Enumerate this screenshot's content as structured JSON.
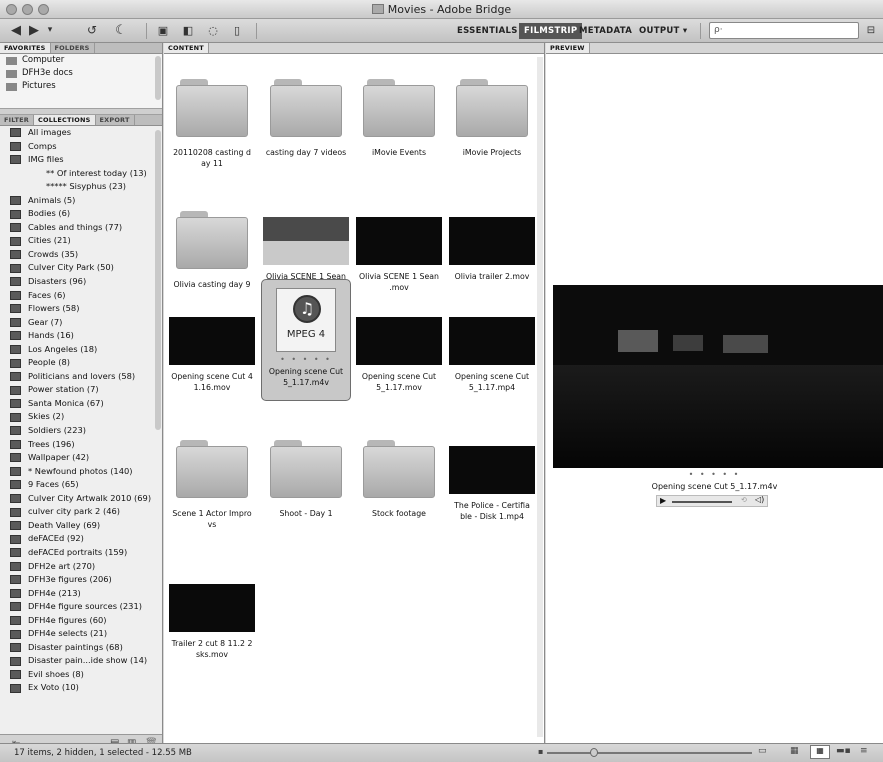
{
  "window": {
    "title": "Movies - Adobe Bridge"
  },
  "toolbar": {
    "back_icon": "arrow-left-icon",
    "forward_icon": "arrow-right-icon",
    "workspaces": [
      "ESSENTIALS",
      "FILMSTRIP",
      "METADATA",
      "OUTPUT ▾"
    ],
    "active_workspace": "FILMSTRIP",
    "search_placeholder": "ρ·"
  },
  "left_top_tabs": [
    "FAVORITES",
    "FOLDERS"
  ],
  "favorites": [
    "Computer",
    "DFH3e docs",
    "Pictures"
  ],
  "left_bottom_tabs": [
    "FILTER",
    "COLLECTIONS",
    "EXPORT"
  ],
  "collections": [
    {
      "label": "All images",
      "sub": false
    },
    {
      "label": "Comps",
      "sub": false
    },
    {
      "label": "IMG files",
      "sub": false
    },
    {
      "label": "** Of interest today (13)",
      "sub": true
    },
    {
      "label": "***** Sisyphus (23)",
      "sub": true
    },
    {
      "label": "Animals (5)",
      "sub": false
    },
    {
      "label": "Bodies (6)",
      "sub": false
    },
    {
      "label": "Cables and things (77)",
      "sub": false
    },
    {
      "label": "Cities (21)",
      "sub": false
    },
    {
      "label": "Crowds (35)",
      "sub": false
    },
    {
      "label": "Culver City Park (50)",
      "sub": false
    },
    {
      "label": "Disasters (96)",
      "sub": false
    },
    {
      "label": "Faces (6)",
      "sub": false
    },
    {
      "label": "Flowers (58)",
      "sub": false
    },
    {
      "label": "Gear (7)",
      "sub": false
    },
    {
      "label": "Hands (16)",
      "sub": false
    },
    {
      "label": "Los Angeles (18)",
      "sub": false
    },
    {
      "label": "People (8)",
      "sub": false
    },
    {
      "label": "Politicians and lovers (58)",
      "sub": false
    },
    {
      "label": "Power station (7)",
      "sub": false
    },
    {
      "label": "Santa Monica (67)",
      "sub": false
    },
    {
      "label": "Skies (2)",
      "sub": false
    },
    {
      "label": "Soldiers (223)",
      "sub": false
    },
    {
      "label": "Trees (196)",
      "sub": false
    },
    {
      "label": "Wallpaper (42)",
      "sub": false
    },
    {
      "label": "* Newfound photos (140)",
      "sub": false
    },
    {
      "label": "9 Faces (65)",
      "sub": false
    },
    {
      "label": "Culver City Artwalk 2010 (69)",
      "sub": false
    },
    {
      "label": "culver city park 2 (46)",
      "sub": false
    },
    {
      "label": "Death Valley (69)",
      "sub": false
    },
    {
      "label": "deFACEd (92)",
      "sub": false
    },
    {
      "label": "deFACEd portraits (159)",
      "sub": false
    },
    {
      "label": "DFH2e art (270)",
      "sub": false
    },
    {
      "label": "DFH3e figures (206)",
      "sub": false
    },
    {
      "label": "DFH4e (213)",
      "sub": false
    },
    {
      "label": "DFH4e figure sources (231)",
      "sub": false
    },
    {
      "label": "DFH4e figures (60)",
      "sub": false
    },
    {
      "label": "DFH4e selects (21)",
      "sub": false
    },
    {
      "label": "Disaster paintings (68)",
      "sub": false
    },
    {
      "label": "Disaster pain...ide show (14)",
      "sub": false
    },
    {
      "label": "Evil shoes (8)",
      "sub": false
    },
    {
      "label": "Ex Voto (10)",
      "sub": false
    }
  ],
  "content": {
    "tab": "CONTENT",
    "items": [
      {
        "type": "folder",
        "label": "20110208 casting d ay 11"
      },
      {
        "type": "folder",
        "label": "casting day 7 videos"
      },
      {
        "type": "folder",
        "label": "iMovie Events"
      },
      {
        "type": "folder",
        "label": "iMovie Projects"
      },
      {
        "type": "folder",
        "label": "Olivia casting day 9"
      },
      {
        "type": "video",
        "label": "Olivia SCENE 1 Sean _MP4 3....16x9).mp4"
      },
      {
        "type": "video",
        "label": "Olivia SCENE 1 Sean .mov"
      },
      {
        "type": "video",
        "label": "Olivia trailer 2.mov"
      },
      {
        "type": "video",
        "label": "Opening scene Cut 4 1.16.mov"
      },
      {
        "type": "mpeg",
        "label": "Opening scene Cut 5_1.17.m4v",
        "selected": true
      },
      {
        "type": "video",
        "label": "Opening scene Cut 5_1.17.mov"
      },
      {
        "type": "video",
        "label": "Opening scene Cut 5_1.17.mp4"
      },
      {
        "type": "folder",
        "label": "Scene 1 Actor Impro vs"
      },
      {
        "type": "folder",
        "label": "Shoot - Day 1"
      },
      {
        "type": "folder",
        "label": "Stock footage"
      },
      {
        "type": "video",
        "label": "The Police - Certifia ble - Disk 1.mp4"
      },
      {
        "type": "video",
        "label": "Trailer 2 cut 8 11.2 2 sks.mov"
      }
    ],
    "mpeg_text": "MPEG 4",
    "dots": "• • • • •"
  },
  "preview": {
    "tab": "PREVIEW",
    "filename": "Opening scene Cut 5_1.17.m4v",
    "dots": "• • • • •"
  },
  "status": {
    "text": "17 items, 2 hidden, 1 selected - 12.55 MB"
  }
}
